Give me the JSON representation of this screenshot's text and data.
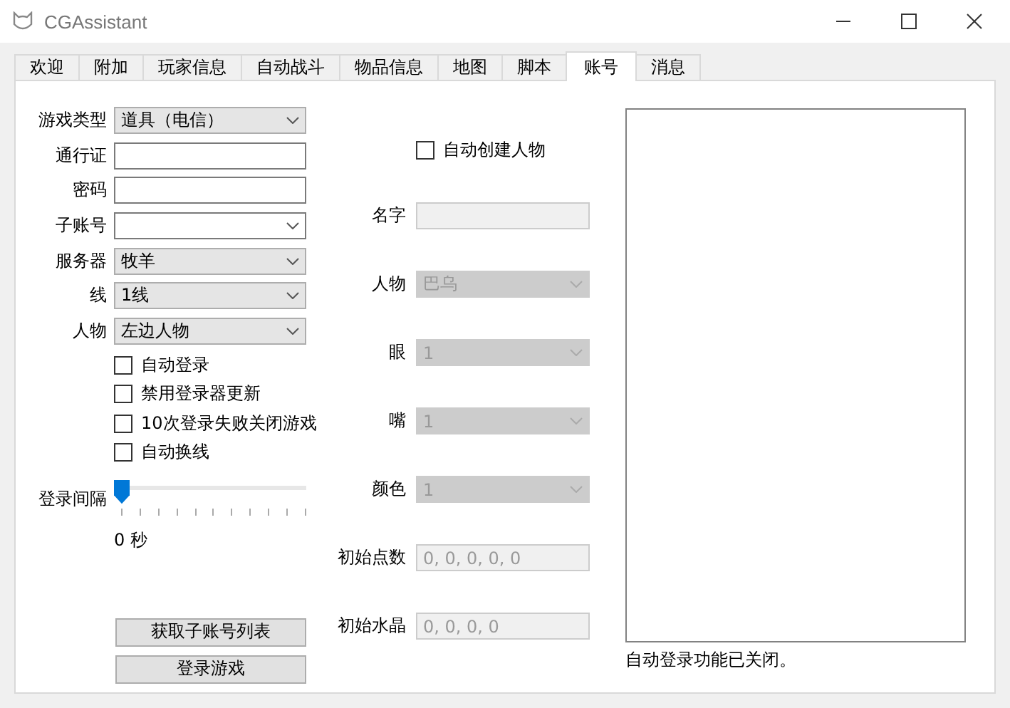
{
  "window": {
    "title": "CGAssistant"
  },
  "tabs": [
    {
      "label": "欢迎",
      "selected": false
    },
    {
      "label": "附加",
      "selected": false
    },
    {
      "label": "玩家信息",
      "selected": false
    },
    {
      "label": "自动战斗",
      "selected": false
    },
    {
      "label": "物品信息",
      "selected": false
    },
    {
      "label": "地图",
      "selected": false
    },
    {
      "label": "脚本",
      "selected": false
    },
    {
      "label": "账号",
      "selected": true
    },
    {
      "label": "消息",
      "selected": false
    }
  ],
  "login": {
    "fields": [
      {
        "label": "游戏类型",
        "kind": "dropdown",
        "value": "道具（电信）"
      },
      {
        "label": "通行证",
        "kind": "text"
      },
      {
        "label": "密码",
        "kind": "text"
      },
      {
        "label": "子账号",
        "kind": "combo"
      },
      {
        "label": "服务器",
        "kind": "dropdown",
        "value": "牧羊"
      },
      {
        "label": "线",
        "kind": "dropdown",
        "value": "1线"
      },
      {
        "label": "人物",
        "kind": "dropdown",
        "value": "左边人物"
      }
    ],
    "checkboxes": [
      {
        "label": "自动登录",
        "checked": false
      },
      {
        "label": "禁用登录器更新",
        "checked": false
      },
      {
        "label": "10次登录失败关闭游戏",
        "checked": false
      },
      {
        "label": "自动换线",
        "checked": false
      }
    ],
    "slider": {
      "label": "登录间隔",
      "level": 0,
      "reading": "0 秒"
    },
    "buttons": [
      "获取子账号列表",
      "登录游戏"
    ]
  },
  "create": {
    "checkbox": {
      "label": "自动创建人物",
      "checked": false
    },
    "fields": [
      {
        "label": "名字",
        "kind": "text",
        "disabled": true
      },
      {
        "label": "人物",
        "kind": "dropdown",
        "value": "巴乌",
        "disabled": true
      },
      {
        "label": "眼",
        "kind": "dropdown",
        "value": "1",
        "disabled": true
      },
      {
        "label": "嘴",
        "kind": "dropdown",
        "value": "1",
        "disabled": true
      },
      {
        "label": "颜色",
        "kind": "dropdown",
        "value": "1",
        "disabled": true
      },
      {
        "label": "初始点数",
        "kind": "text",
        "value": "0, 0, 0, 0, 0",
        "disabled": true
      },
      {
        "label": "初始水晶",
        "kind": "text",
        "value": "0, 0, 0, 0",
        "disabled": true
      }
    ]
  },
  "log": {
    "status": "自动登录功能已关闭。"
  }
}
